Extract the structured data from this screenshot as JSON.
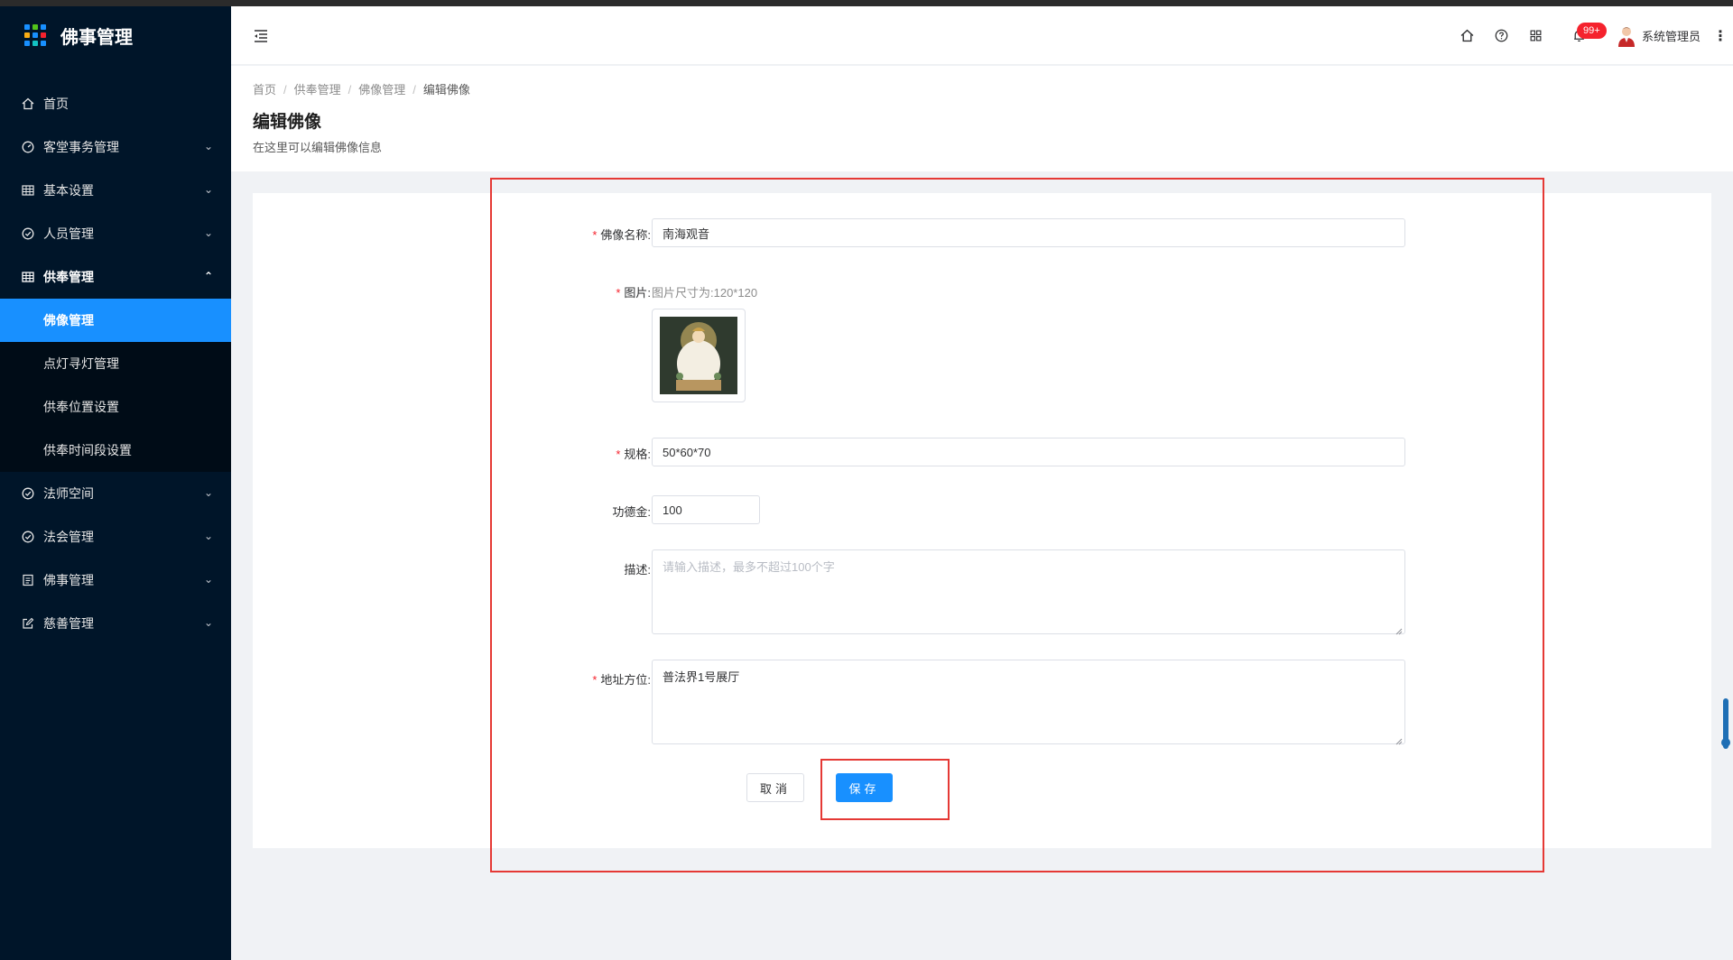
{
  "app": {
    "title": "佛事管理"
  },
  "colors": {
    "sidebar_bg": "#001529",
    "active": "#1890ff",
    "highlight": "#e53935",
    "required": "#f5222d"
  },
  "sidebar": {
    "items": [
      {
        "label": "首页",
        "icon": "home-icon"
      },
      {
        "label": "客堂事务管理",
        "icon": "dashboard-icon"
      },
      {
        "label": "基本设置",
        "icon": "table-icon"
      },
      {
        "label": "人员管理",
        "icon": "check-circle-icon"
      },
      {
        "label": "供奉管理",
        "icon": "table-icon"
      },
      {
        "label": "法师空间",
        "icon": "check-circle-icon"
      },
      {
        "label": "法会管理",
        "icon": "check-circle-icon"
      },
      {
        "label": "佛事管理",
        "icon": "profile-icon"
      },
      {
        "label": "慈善管理",
        "icon": "edit-icon"
      }
    ],
    "submenu": [
      {
        "label": "佛像管理"
      },
      {
        "label": "点灯寻灯管理"
      },
      {
        "label": "供奉位置设置"
      },
      {
        "label": "供奉时间段设置"
      }
    ]
  },
  "header": {
    "notification_count": "99+",
    "user_name": "系统管理员"
  },
  "breadcrumb": [
    "首页",
    "供奉管理",
    "佛像管理",
    "编辑佛像"
  ],
  "page": {
    "title": "编辑佛像",
    "description": "在这里可以编辑佛像信息"
  },
  "form": {
    "name_label": "佛像名称:",
    "name_value": "南海观音",
    "image_label": "图片:",
    "image_hint": "图片尺寸为:120*120",
    "spec_label": "规格:",
    "spec_value": "50*60*70",
    "merit_label": "功德金:",
    "merit_value": "100",
    "desc_label": "描述:",
    "desc_placeholder": "请输入描述，最多不超过100个字",
    "address_label": "地址方位:",
    "address_value": "普法界1号展厅",
    "cancel_label": "取消",
    "save_label": "保存",
    "required_mark": "*"
  }
}
